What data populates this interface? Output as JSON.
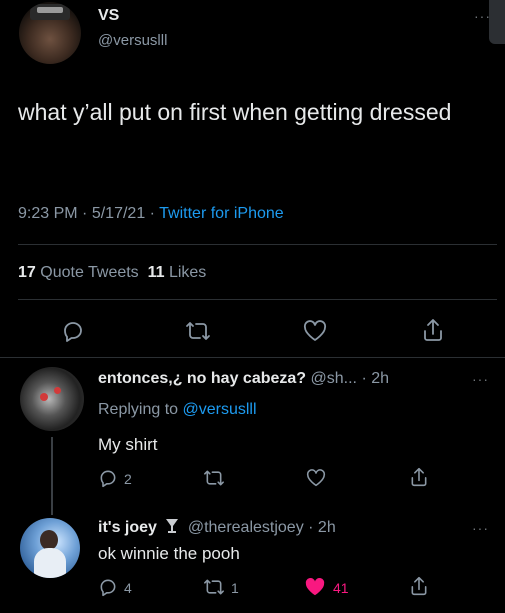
{
  "main_tweet": {
    "display_name": "VS",
    "handle": "@versuslll",
    "text": "what y’all put on first when getting dressed",
    "time": "9:23 PM",
    "sep1": "·",
    "date": "5/17/21",
    "sep2": "·",
    "source": "Twitter for iPhone",
    "quote_count": "17",
    "quote_label": "Quote Tweets",
    "like_count": "11",
    "like_label": "Likes"
  },
  "replies": [
    {
      "display_name": "entonces,¿ no hay cabeza?",
      "handle": "@sh...",
      "time": "· 2h",
      "replying_prefix": "Replying to",
      "replying_to": "@versuslll",
      "text": "My shirt",
      "reply_count": "2",
      "retweet_count": "",
      "like_count": ""
    },
    {
      "display_name": "it's joey",
      "handle": "@therealestjoey",
      "time": "· 2h",
      "text": "ok winnie the pooh",
      "reply_count": "4",
      "retweet_count": "1",
      "like_count": "41"
    }
  ],
  "icons": {
    "reply": "reply-icon",
    "retweet": "retweet-icon",
    "like": "heart-icon",
    "share": "share-icon",
    "more": "more-icon",
    "badge": "goblet-badge-icon"
  },
  "colors": {
    "background": "#000000",
    "text": "#e7e9ea",
    "muted": "#8b98a5",
    "link": "#1d9bf0",
    "liked": "#f91880",
    "divider": "#2b2f33"
  }
}
